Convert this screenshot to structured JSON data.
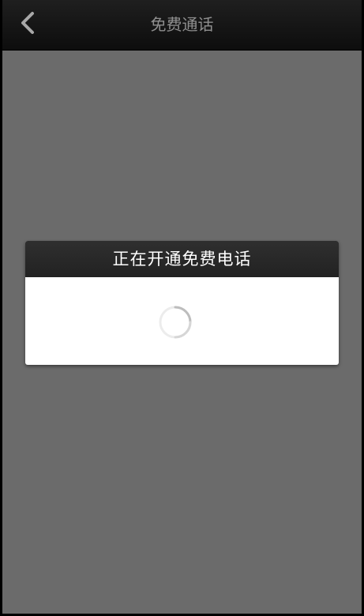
{
  "navbar": {
    "title": "免费通话",
    "back_icon": "chevron-left-icon"
  },
  "dialog": {
    "title": "正在开通免费电话",
    "spinner_icon": "loading-spinner-icon"
  },
  "colors": {
    "navbar_bg": "#141414",
    "overlay_bg": "#6b6b6b",
    "dialog_header_bg": "#2a2a2a",
    "dialog_body_bg": "#ffffff",
    "title_text": "#8f8f8f"
  }
}
